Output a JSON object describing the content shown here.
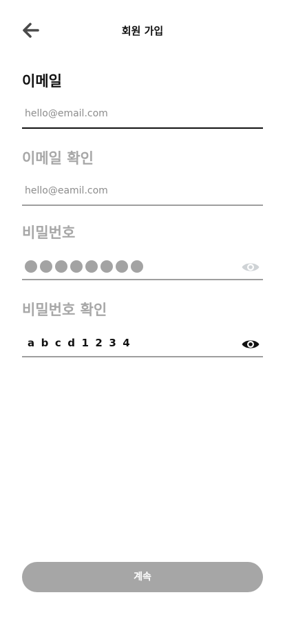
{
  "header": {
    "title": "회원 가입",
    "back_icon": "arrow-left-icon"
  },
  "fields": {
    "email": {
      "label": "이메일",
      "value": "hello@email.com"
    },
    "email_confirm": {
      "label": "이메일 확인",
      "value": "hello@eamil.com"
    },
    "password": {
      "label": "비밀번호",
      "masked_char_count": 8,
      "visibility_icon": "eye-icon"
    },
    "password_confirm": {
      "label": "비밀번호 확인",
      "value": "abcd1234",
      "visibility_icon": "eye-icon"
    }
  },
  "footer": {
    "continue_label": "계속"
  },
  "colors": {
    "text_active": "#111111",
    "text_inactive": "#a7a7a7",
    "button_disabled": "#a6a6a6",
    "underline_focus": "#111111",
    "underline_default": "#9e9e9e"
  }
}
